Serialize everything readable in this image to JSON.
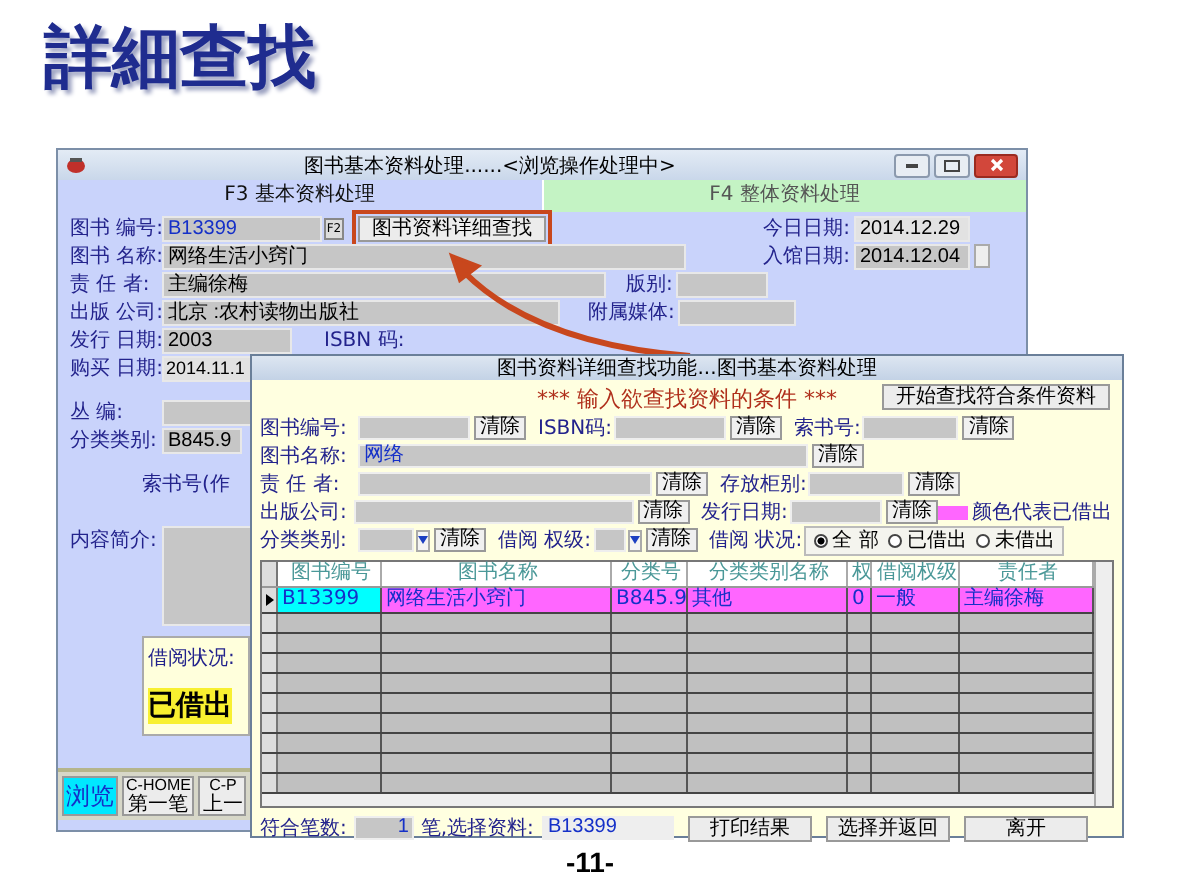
{
  "slide": {
    "title": "詳細查找",
    "page_number": "-11-"
  },
  "main_window": {
    "title": "图书基本资料处理......<浏览操作处理中>",
    "tabs": [
      {
        "label": "F3 基本资料处理",
        "selected": true
      },
      {
        "label": "F4 整体资料处理",
        "selected": false
      }
    ],
    "book_no": {
      "label": "图书 编号:",
      "value": "B13399",
      "key": "F2"
    },
    "detail_search_button": "图书资料详细查找",
    "today": {
      "label": "今日日期:",
      "value": "2014.12.29"
    },
    "entry_date": {
      "label": "入馆日期:",
      "value": "2014.12.04"
    },
    "book_title": {
      "label": "图书 名称:",
      "value": "网络生活小窍门"
    },
    "author": {
      "label": "责 任 者:",
      "value": "主编徐梅"
    },
    "edition": {
      "label": "版别:"
    },
    "publisher": {
      "label": "出版 公司:",
      "value": "北京 :农村读物出版社"
    },
    "attachment": {
      "label": "附属媒体:"
    },
    "issue_date": {
      "label": "发行 日期:",
      "value": "2003"
    },
    "isbn": {
      "label": "ISBN 码:"
    },
    "purchase_date": {
      "label": "购买 日期:",
      "value": "2014.11.1"
    },
    "series": {
      "label": "丛    编:"
    },
    "category": {
      "label": "分类类别:",
      "value": "B845.9"
    },
    "call_no_label": "索书号(作",
    "summary": {
      "label": "内容简介:"
    },
    "loan": {
      "label": "借阅状况:",
      "value": "已借出"
    },
    "nav_buttons": [
      {
        "key": "浏览",
        "selected": true
      },
      {
        "key": "C-HOME",
        "label": "第一笔",
        "selected": false
      },
      {
        "key": "C-P",
        "label": "上一",
        "selected": false
      }
    ]
  },
  "dialog": {
    "title": "图书资料详细查找功能...图书基本资料处理",
    "heading": "*** 输入欲查找资料的条件 ***",
    "start_button": "开始查找符合条件资料",
    "rows": [
      [
        {
          "label": "图书编号:",
          "clear": "清除"
        },
        {
          "label": "ISBN码:",
          "clear": "清除"
        },
        {
          "label": "索书号:",
          "clear": "清除"
        }
      ],
      [
        {
          "label": "图书名称:",
          "value": "网络",
          "clear": "清除"
        }
      ],
      [
        {
          "label": "责 任 者:",
          "clear": "清除"
        },
        {
          "label": "存放柜别:",
          "clear": "清除"
        }
      ],
      [
        {
          "label": "出版公司:",
          "clear": "清除"
        },
        {
          "label": "发行日期:",
          "clear": "清除"
        }
      ],
      [
        {
          "label": "分类类别:",
          "clear": "清除",
          "kind": "spinner"
        },
        {
          "label": "借阅 权级:",
          "clear": "清除",
          "kind": "spinner"
        }
      ]
    ],
    "loan_status": {
      "label": "借阅 状况:",
      "options": [
        {
          "label": "全 部",
          "selected": true
        },
        {
          "label": "已借出",
          "selected": false
        },
        {
          "label": "未借出",
          "selected": false
        }
      ]
    },
    "legend": {
      "color": "#ff66ff",
      "label": "颜色代表已借出"
    },
    "table": {
      "columns": [
        "图书编号",
        "图书名称",
        "分类号",
        "分类类别名称",
        "权",
        "借阅权级",
        "责任者"
      ],
      "rows": [
        {
          "selected": true,
          "borrowed": true,
          "cells": [
            "B13399",
            "网络生活小窍门",
            "B845.9",
            "其他",
            "0",
            "一般",
            "主编徐梅"
          ]
        }
      ]
    },
    "footer": {
      "count_label": "符合笔数:",
      "count": "1",
      "selected_label": "笔,选择资料:",
      "selected_value": "B13399",
      "buttons": [
        "打印结果",
        "选择并返回",
        "离开"
      ]
    }
  }
}
